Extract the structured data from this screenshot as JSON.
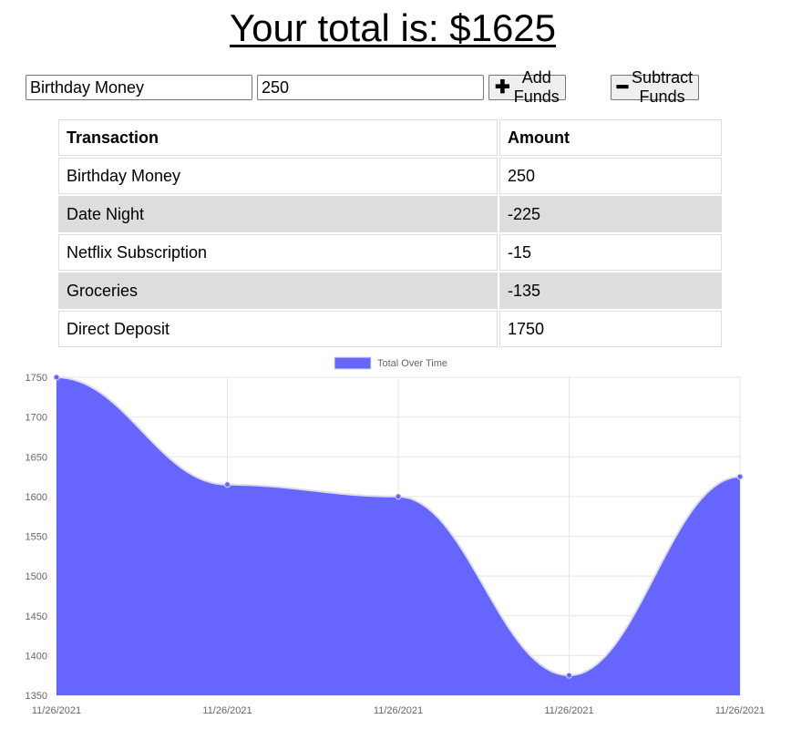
{
  "header": {
    "title": "Your total is: $1625"
  },
  "form": {
    "name_value": "Birthday Money",
    "amount_value": "250",
    "add_label": "Add Funds",
    "subtract_label": "Subtract Funds"
  },
  "table": {
    "headers": [
      "Transaction",
      "Amount"
    ],
    "rows": [
      [
        "Birthday Money",
        "250"
      ],
      [
        "Date Night",
        "-225"
      ],
      [
        "Netflix Subscription",
        "-15"
      ],
      [
        "Groceries",
        "-135"
      ],
      [
        "Direct Deposit",
        "1750"
      ]
    ]
  },
  "chart_data": {
    "type": "area",
    "legend": "Total Over Time",
    "fill_color": "#6666ff",
    "line_color": "#dcdcf0",
    "categories": [
      "11/26/2021",
      "11/26/2021",
      "11/26/2021",
      "11/26/2021",
      "11/26/2021"
    ],
    "values": [
      1750,
      1615,
      1600,
      1375,
      1625
    ],
    "ylim": [
      1350,
      1750
    ],
    "yticks": [
      1750,
      1700,
      1650,
      1600,
      1550,
      1500,
      1450,
      1400,
      1350
    ],
    "grid": true,
    "legend_position": "top"
  }
}
